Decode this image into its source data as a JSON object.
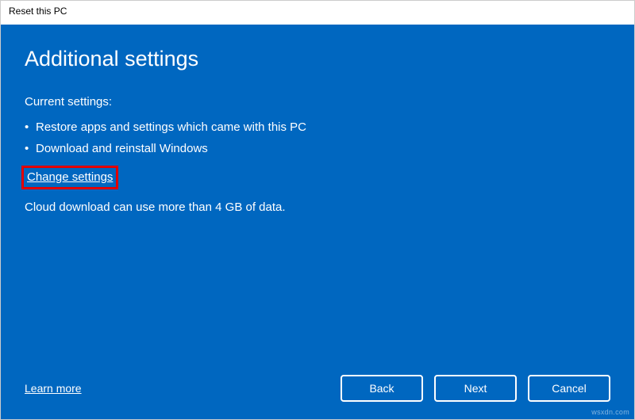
{
  "window": {
    "title": "Reset this PC"
  },
  "main": {
    "heading": "Additional settings",
    "current_settings_label": "Current settings:",
    "bullets": [
      "Restore apps and settings which came with this PC",
      "Download and reinstall Windows"
    ],
    "change_link": "Change settings",
    "note": "Cloud download can use more than 4 GB of data."
  },
  "footer": {
    "learn_more": "Learn more",
    "back": "Back",
    "next": "Next",
    "cancel": "Cancel"
  },
  "watermark": "wsxdn.com"
}
